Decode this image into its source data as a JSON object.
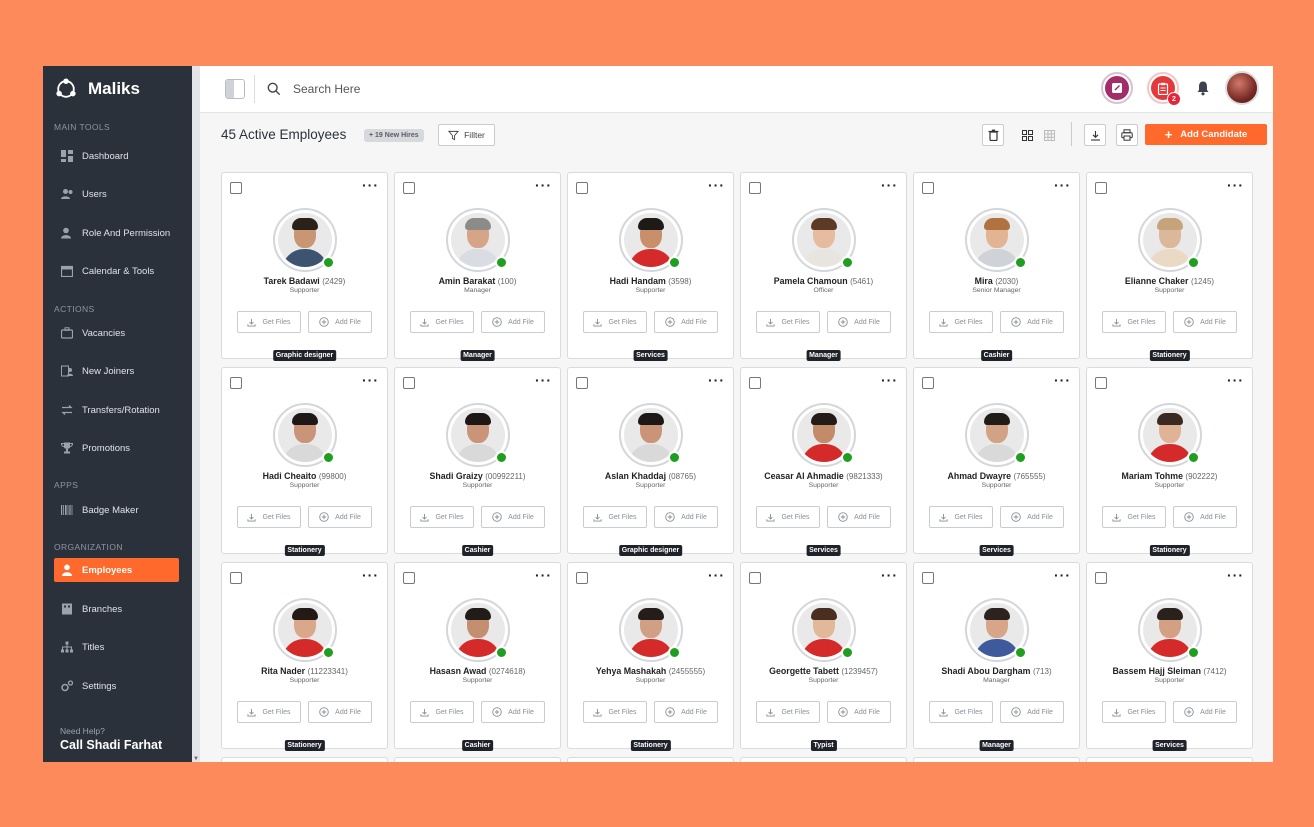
{
  "app": {
    "name": "Maliks"
  },
  "sidebar": {
    "sections": [
      {
        "label": "MAIN TOOLS",
        "items": [
          {
            "label": "Dashboard",
            "icon": "dashboard-icon"
          },
          {
            "label": "Users",
            "icon": "users-icon"
          },
          {
            "label": "Role And Permission",
            "icon": "role-icon"
          },
          {
            "label": "Calendar & Tools",
            "icon": "calendar-icon"
          }
        ]
      },
      {
        "label": "ACTIONS",
        "items": [
          {
            "label": "Vacancies",
            "icon": "briefcase-icon"
          },
          {
            "label": "New Joiners",
            "icon": "new-joiners-icon"
          },
          {
            "label": "Transfers/Rotation",
            "icon": "transfer-icon"
          },
          {
            "label": "Promotions",
            "icon": "trophy-icon"
          }
        ]
      },
      {
        "label": "APPS",
        "items": [
          {
            "label": "Badge Maker",
            "icon": "barcode-icon"
          }
        ]
      },
      {
        "label": "ORGANIZATION",
        "items": [
          {
            "label": "Employees",
            "icon": "employee-icon",
            "active": true
          },
          {
            "label": "Branches",
            "icon": "branches-icon"
          },
          {
            "label": "Titles",
            "icon": "titles-icon"
          },
          {
            "label": "Settings",
            "icon": "settings-icon"
          }
        ]
      }
    ],
    "help": {
      "line1": "Need Help?",
      "line2": "Call Shadi Farhat"
    }
  },
  "topbar": {
    "search_placeholder": "Search Here",
    "notification_count": "2"
  },
  "toolbar": {
    "title": "45 Active Employees",
    "new_hires": "+ 19 New Hires",
    "filter_label": "Fillter",
    "add_label": "Add Candidate"
  },
  "card_labels": {
    "get_files": "Get Files",
    "add_file": "Add File"
  },
  "employees": [
    {
      "name": "Tarek Badawi",
      "code": "(2429)",
      "role": "Supporter",
      "tag": "Graphic designer",
      "skin": "#c99673",
      "hair": "#2a211b",
      "shirt": "#3c5470"
    },
    {
      "name": "Amin Barakat",
      "code": "(100)",
      "role": "Manager",
      "tag": "Manager",
      "skin": "#d6a587",
      "hair": "#8d8b88",
      "shirt": "#d9dce3"
    },
    {
      "name": "Hadi Handam",
      "code": "(3598)",
      "role": "Supporter",
      "tag": "Services",
      "skin": "#c98f6b",
      "hair": "#1e1a17",
      "shirt": "#d42a2a"
    },
    {
      "name": "Pamela Chamoun",
      "code": "(5461)",
      "role": "Officer",
      "tag": "Manager",
      "skin": "#e6bca0",
      "hair": "#5b3b26",
      "shirt": "#e8e5e0"
    },
    {
      "name": "Mira",
      "code": "(2030)",
      "role": "Senior Manager",
      "tag": "Cashier",
      "skin": "#e3b493",
      "hair": "#b0733f",
      "shirt": "#cfd2d6"
    },
    {
      "name": "Elianne Chaker",
      "code": "(1245)",
      "role": "Supporter",
      "tag": "Stationery",
      "skin": "#dcb89a",
      "hair": "#c5a37b",
      "shirt": "#ead9c4"
    },
    {
      "name": "Hadi Cheaito",
      "code": "(99800)",
      "role": "Supporter",
      "tag": "Stationery",
      "skin": "#c99478",
      "hair": "#1d1816",
      "shirt": "#d9d9d9"
    },
    {
      "name": "Shadi Graizy",
      "code": "(00992211)",
      "role": "Supporter",
      "tag": "Cashier",
      "skin": "#c99478",
      "hair": "#1d1816",
      "shirt": "#d9d9d9"
    },
    {
      "name": "Aslan Khaddaj",
      "code": "(08765)",
      "role": "Supporter",
      "tag": "Graphic designer",
      "skin": "#c99478",
      "hair": "#1d1816",
      "shirt": "#d9d9d9"
    },
    {
      "name": "Ceasar Al Ahmadie",
      "code": "(9821333)",
      "role": "Supporter",
      "tag": "Services",
      "skin": "#c48b6a",
      "hair": "#231c18",
      "shirt": "#d42a2a"
    },
    {
      "name": "Ahmad Dwayre",
      "code": "(765555)",
      "role": "Supporter",
      "tag": "Services",
      "skin": "#d2a284",
      "hair": "#221c19",
      "shirt": "#d9d9d9"
    },
    {
      "name": "Mariam Tohme",
      "code": "(902222)",
      "role": "Supporter",
      "tag": "Stationery",
      "skin": "#e0b296",
      "hair": "#3a2a21",
      "shirt": "#d42a2a"
    },
    {
      "name": "Rita Nader",
      "code": "(11223341)",
      "role": "Supporter",
      "tag": "Stationery",
      "skin": "#d9a88a",
      "hair": "#231a16",
      "shirt": "#d42a2a"
    },
    {
      "name": "Hasasn Awad",
      "code": "(0274618)",
      "role": "Supporter",
      "tag": "Cashier",
      "skin": "#c48e70",
      "hair": "#221c19",
      "shirt": "#d42a2a"
    },
    {
      "name": "Yehya Mashakah",
      "code": "(2455555)",
      "role": "Supporter",
      "tag": "Stationery",
      "skin": "#d0a085",
      "hair": "#241d19",
      "shirt": "#d42a2a"
    },
    {
      "name": "Georgette Tabett",
      "code": "(1239457)",
      "role": "Supporter",
      "tag": "Typist",
      "skin": "#e2b89a",
      "hair": "#4a2f20",
      "shirt": "#d42a2a"
    },
    {
      "name": "Shadi Abou Dargham",
      "code": "(713)",
      "role": "Manager",
      "tag": "Manager",
      "skin": "#d7a688",
      "hair": "#2c2320",
      "shirt": "#3e5a9c"
    },
    {
      "name": "Bassem Hajj Sleiman",
      "code": "(7412)",
      "role": "Supporter",
      "tag": "Services",
      "skin": "#d3a083",
      "hair": "#2b211c",
      "shirt": "#d42a2a"
    }
  ]
}
